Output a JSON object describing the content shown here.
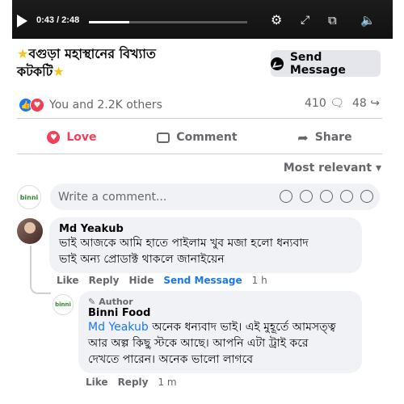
{
  "video": {
    "time": "0:43 / 2:48",
    "progress_fraction": 0.256,
    "icons": [
      "play-icon",
      "settings-icon",
      "fullscreen-icon",
      "pip-icon",
      "volume-icon"
    ]
  },
  "post": {
    "title_line1": "বগুড়া মহাস্থানের বিখ্যাত",
    "title_line2": "কটকটি",
    "send_message_label": "Send Message"
  },
  "reactions": {
    "summary": "You and 2.2K others",
    "comments_count": "410",
    "shares_count": "48"
  },
  "actions": {
    "love_label": "Love",
    "comment_label": "Comment",
    "share_label": "Share"
  },
  "sort": {
    "label": "Most relevant"
  },
  "composer": {
    "placeholder": "Write a comment..."
  },
  "comments": [
    {
      "author": "Md Yeakub",
      "text_line1": "ভাই আজকে আমি হাতে পাইলাম খুব মজা হলো ধন্যবাদ",
      "text_line2": "ভাই অন্য প্রোডাক্ট থাকলে জানাইয়েন",
      "actions": {
        "like": "Like",
        "reply": "Reply",
        "hide": "Hide",
        "send_message": "Send Message",
        "time": "1 h"
      }
    }
  ],
  "reply": {
    "badge": "Author",
    "author": "Binni Food",
    "mention": "Md Yeakub",
    "text_line1": " অনেক ধন্যবাদ ভাই। এই মুহূর্তে আমসত্ত্ব",
    "text_line2": "আর অল্প কিছু স্টকে আছে। আপনি এটা ট্রাই করে",
    "text_line3": "দেখতে পারেন। অনেক ভালো লাগবে",
    "actions": {
      "like": "Like",
      "reply": "Reply",
      "time": "1 m"
    }
  },
  "colors": {
    "accent": "#1877f2",
    "love": "#f33e58",
    "muted": "#65676b",
    "bubble": "#f0f2f5"
  }
}
